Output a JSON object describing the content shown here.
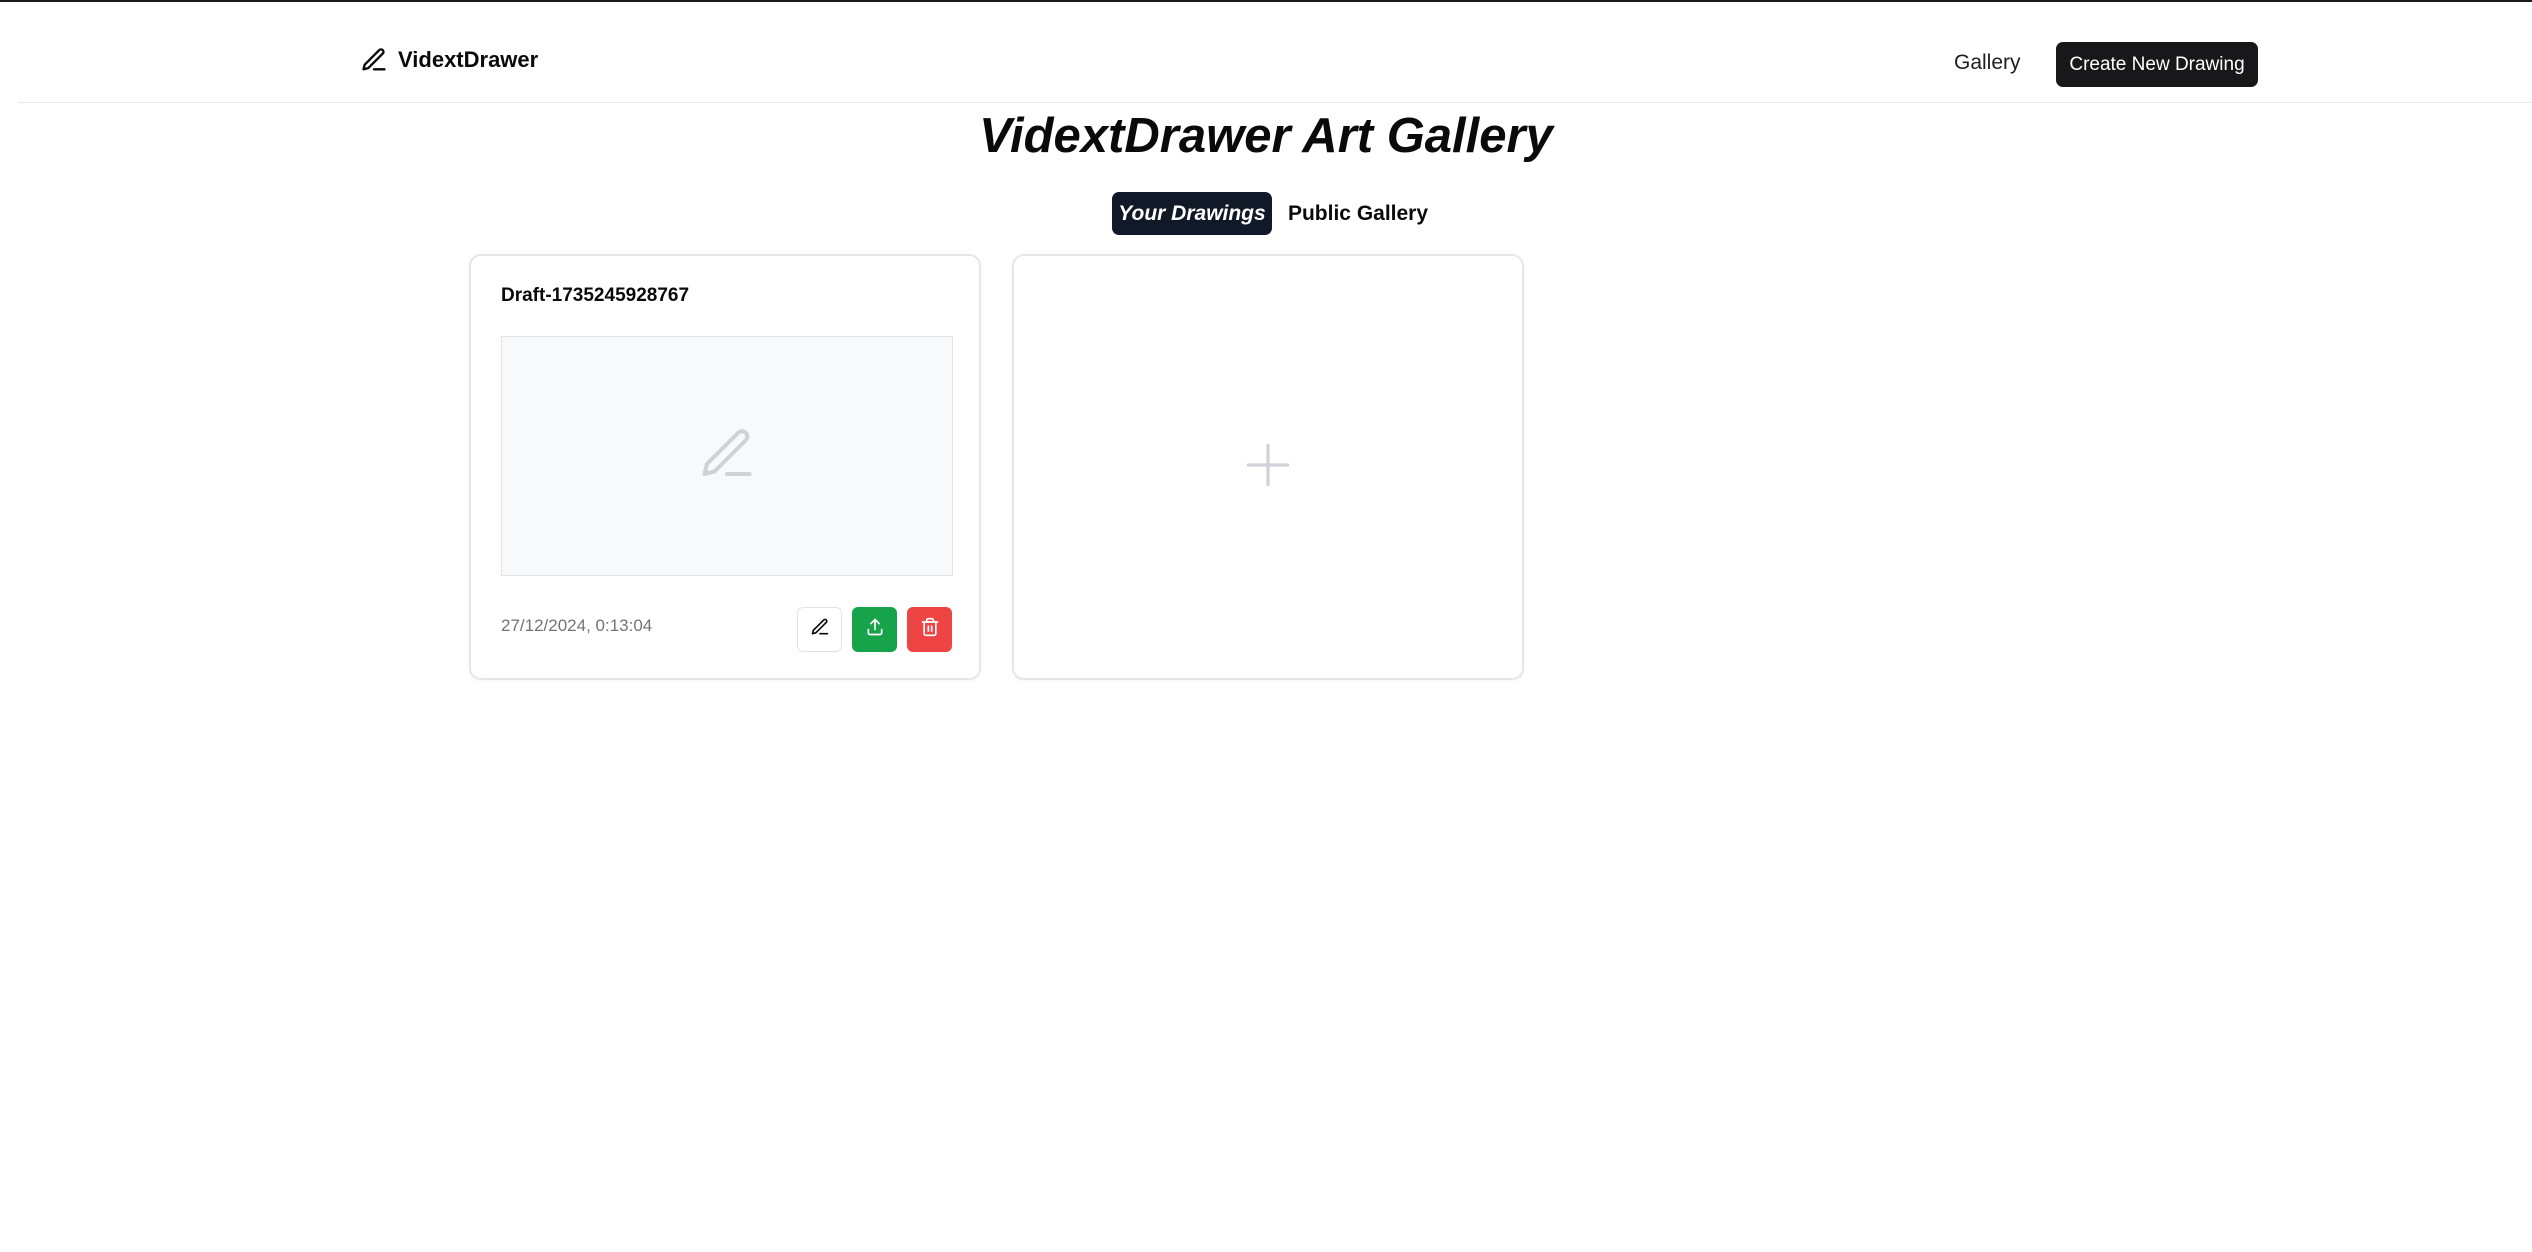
{
  "header": {
    "brand_name": "VidextDrawer",
    "brand_icon": "pencil-icon",
    "nav_gallery_label": "Gallery",
    "create_button_label": "Create New Drawing"
  },
  "page": {
    "title": "VidextDrawer Art Gallery"
  },
  "tabs": [
    {
      "label": "Your Drawings",
      "active": true
    },
    {
      "label": "Public Gallery",
      "active": false
    }
  ],
  "drawings": [
    {
      "title": "Draft-1735245928767",
      "timestamp": "27/12/2024, 0:13:04",
      "thumbnail_icon": "pencil-icon",
      "actions": [
        "edit-icon",
        "upload-icon",
        "trash-icon"
      ]
    }
  ],
  "new_drawing_card": {
    "icon": "plus-icon"
  },
  "colors": {
    "primary_dark": "#18181b",
    "tab_active": "#111827",
    "publish_green": "#16a34a",
    "delete_red": "#ef4444",
    "muted_text": "#737373",
    "placeholder_icon": "#cfd2d6"
  }
}
